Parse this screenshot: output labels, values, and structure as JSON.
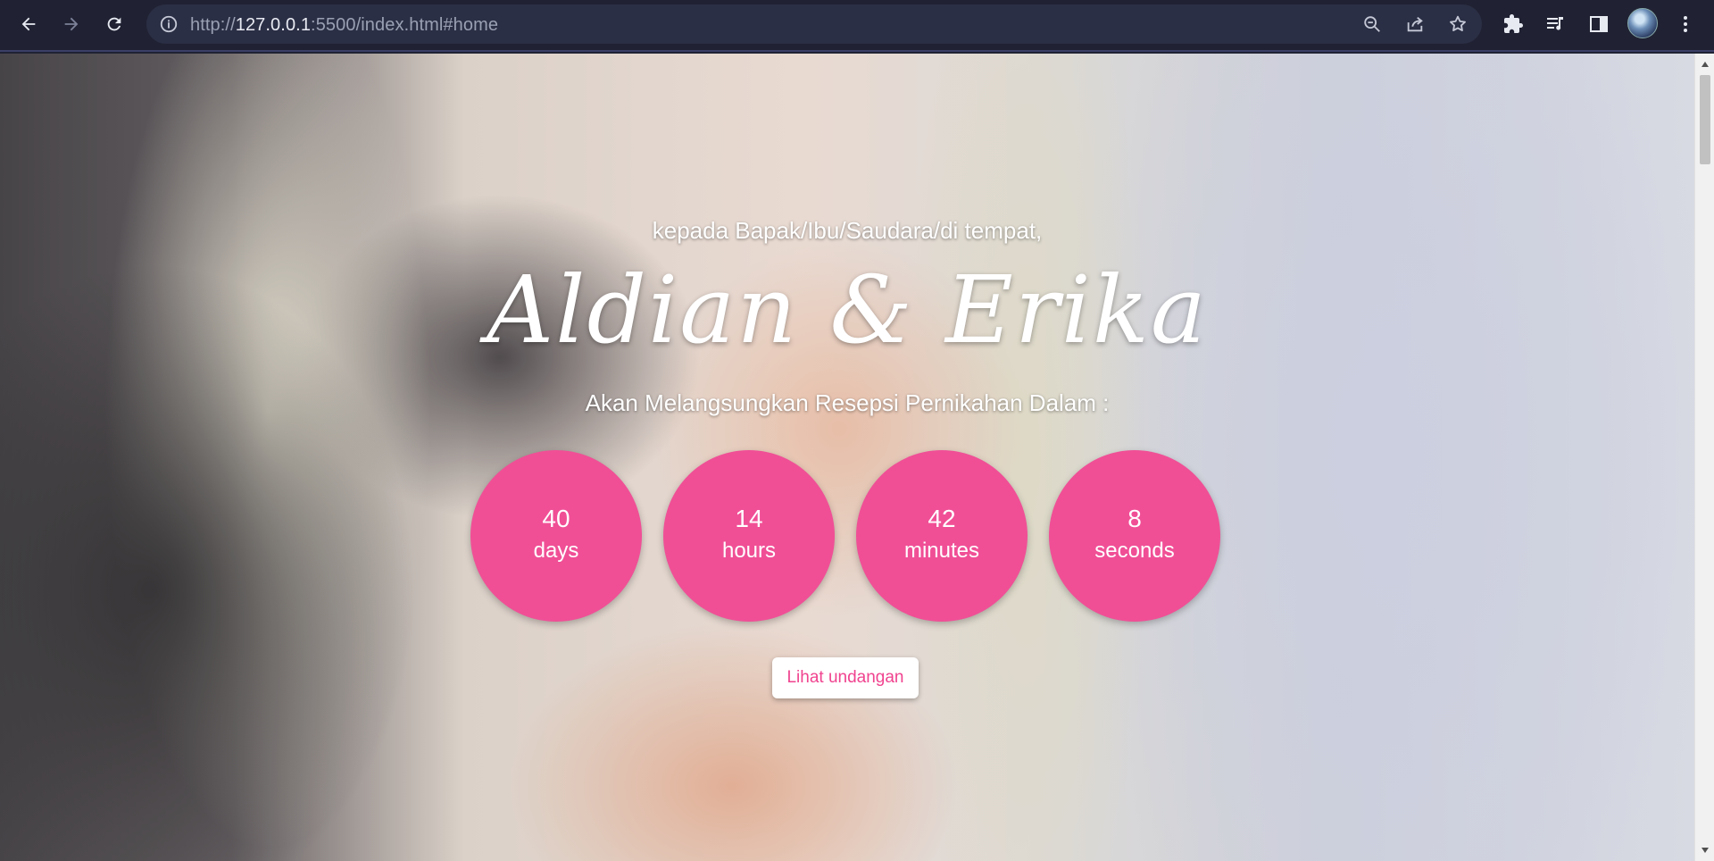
{
  "browser": {
    "url_scheme": "http://",
    "url_host": "127.0.0.1",
    "url_rest": ":5500/index.html#home",
    "icons": [
      "back-arrow-icon",
      "forward-arrow-icon",
      "reload-icon",
      "info-icon",
      "zoom-out-icon",
      "share-icon",
      "star-icon",
      "extensions-icon",
      "media-queue-icon",
      "side-panel-icon",
      "avatar",
      "more-vert-icon"
    ]
  },
  "hero": {
    "salutation": "kepada Bapak/Ibu/Saudara/di tempat,",
    "couple": "Aldian & Erika",
    "announce": "Akan Melangsungkan Resepsi Pernikahan Dalam :",
    "countdown": [
      {
        "value": "40",
        "unit": "days"
      },
      {
        "value": "14",
        "unit": "hours"
      },
      {
        "value": "42",
        "unit": "minutes"
      },
      {
        "value": "8",
        "unit": "seconds"
      }
    ],
    "cta_label": "Lihat undangan"
  },
  "colors": {
    "accent_pink": "#f04f96",
    "cta_text": "#f0438f",
    "chrome_bg": "#202233"
  }
}
